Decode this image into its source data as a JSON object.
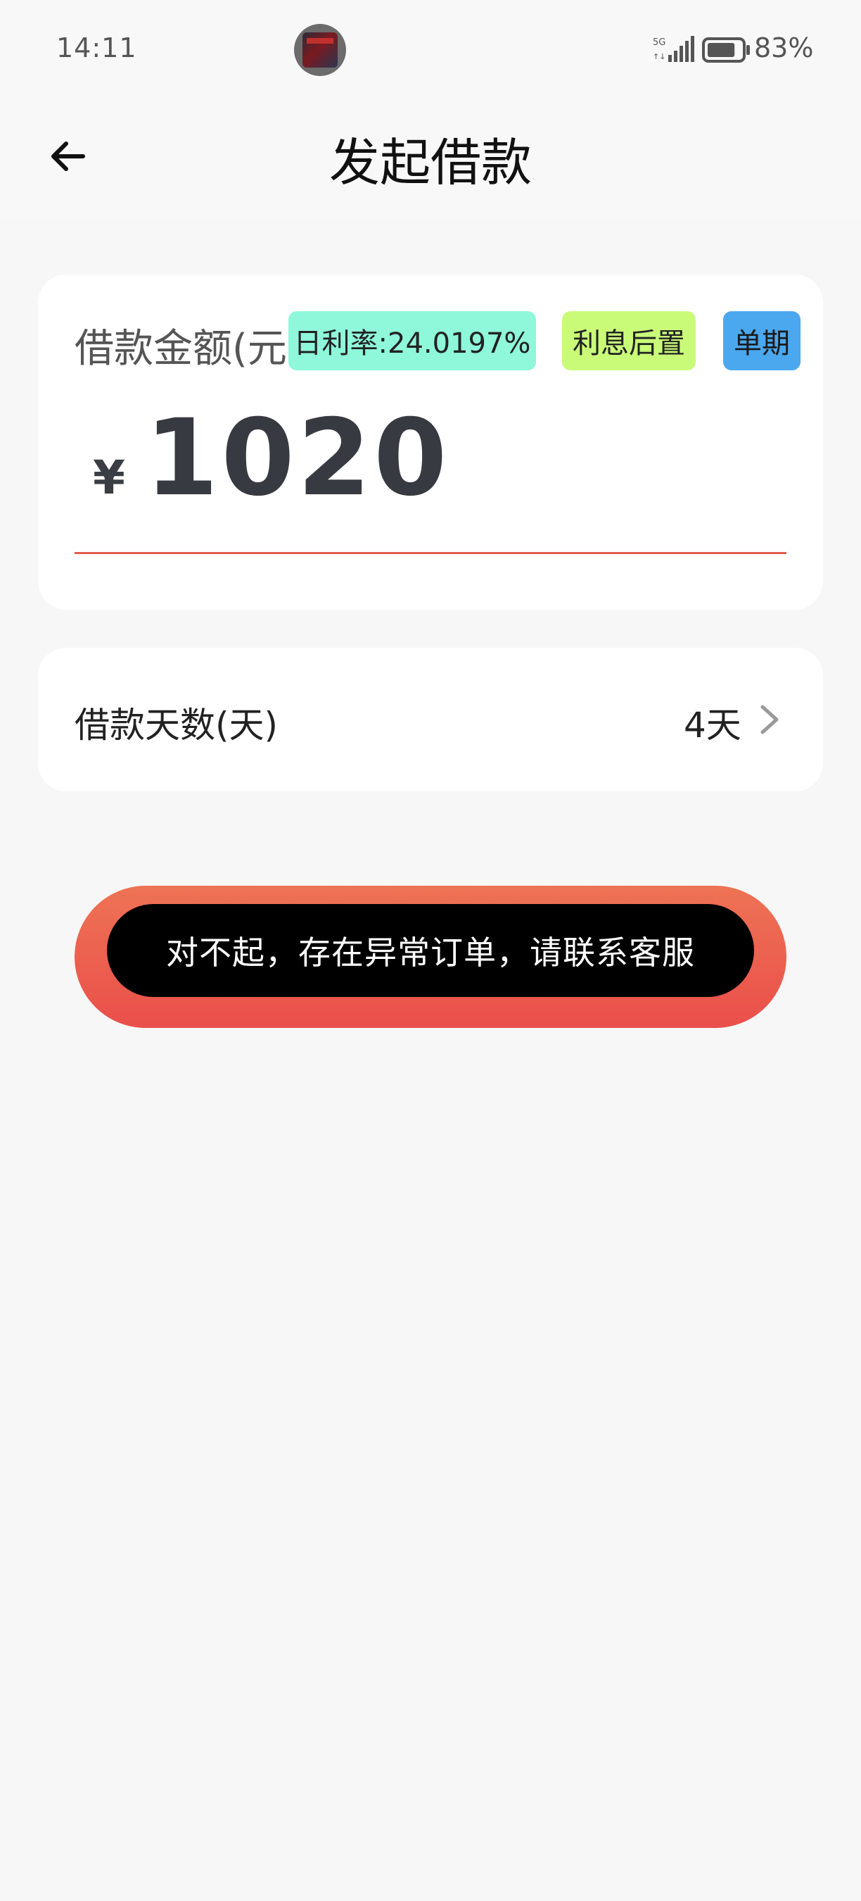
{
  "status_bar": {
    "time": "14:11",
    "network_label": "5G",
    "battery_percent": "83%",
    "battery_level": 0.83
  },
  "header": {
    "title": "发起借款",
    "back_icon": "arrow-left-icon"
  },
  "amount_card": {
    "label": "借款金额(元)",
    "tags": {
      "rate": "日利率:24.0197%",
      "interest": "利息后置",
      "period": "单期"
    },
    "currency_symbol": "¥",
    "amount": "1020"
  },
  "days_card": {
    "label": "借款天数(天)",
    "value": "4天",
    "chevron_icon": "chevron-right-icon"
  },
  "toast": {
    "message": "对不起，存在异常订单，请联系客服"
  },
  "colors": {
    "accent_red": "#ea4f4a",
    "tag_rate_bg": "#8ff7da",
    "tag_interest_bg": "#c9fb79",
    "tag_period_bg": "#4ba8ef"
  }
}
